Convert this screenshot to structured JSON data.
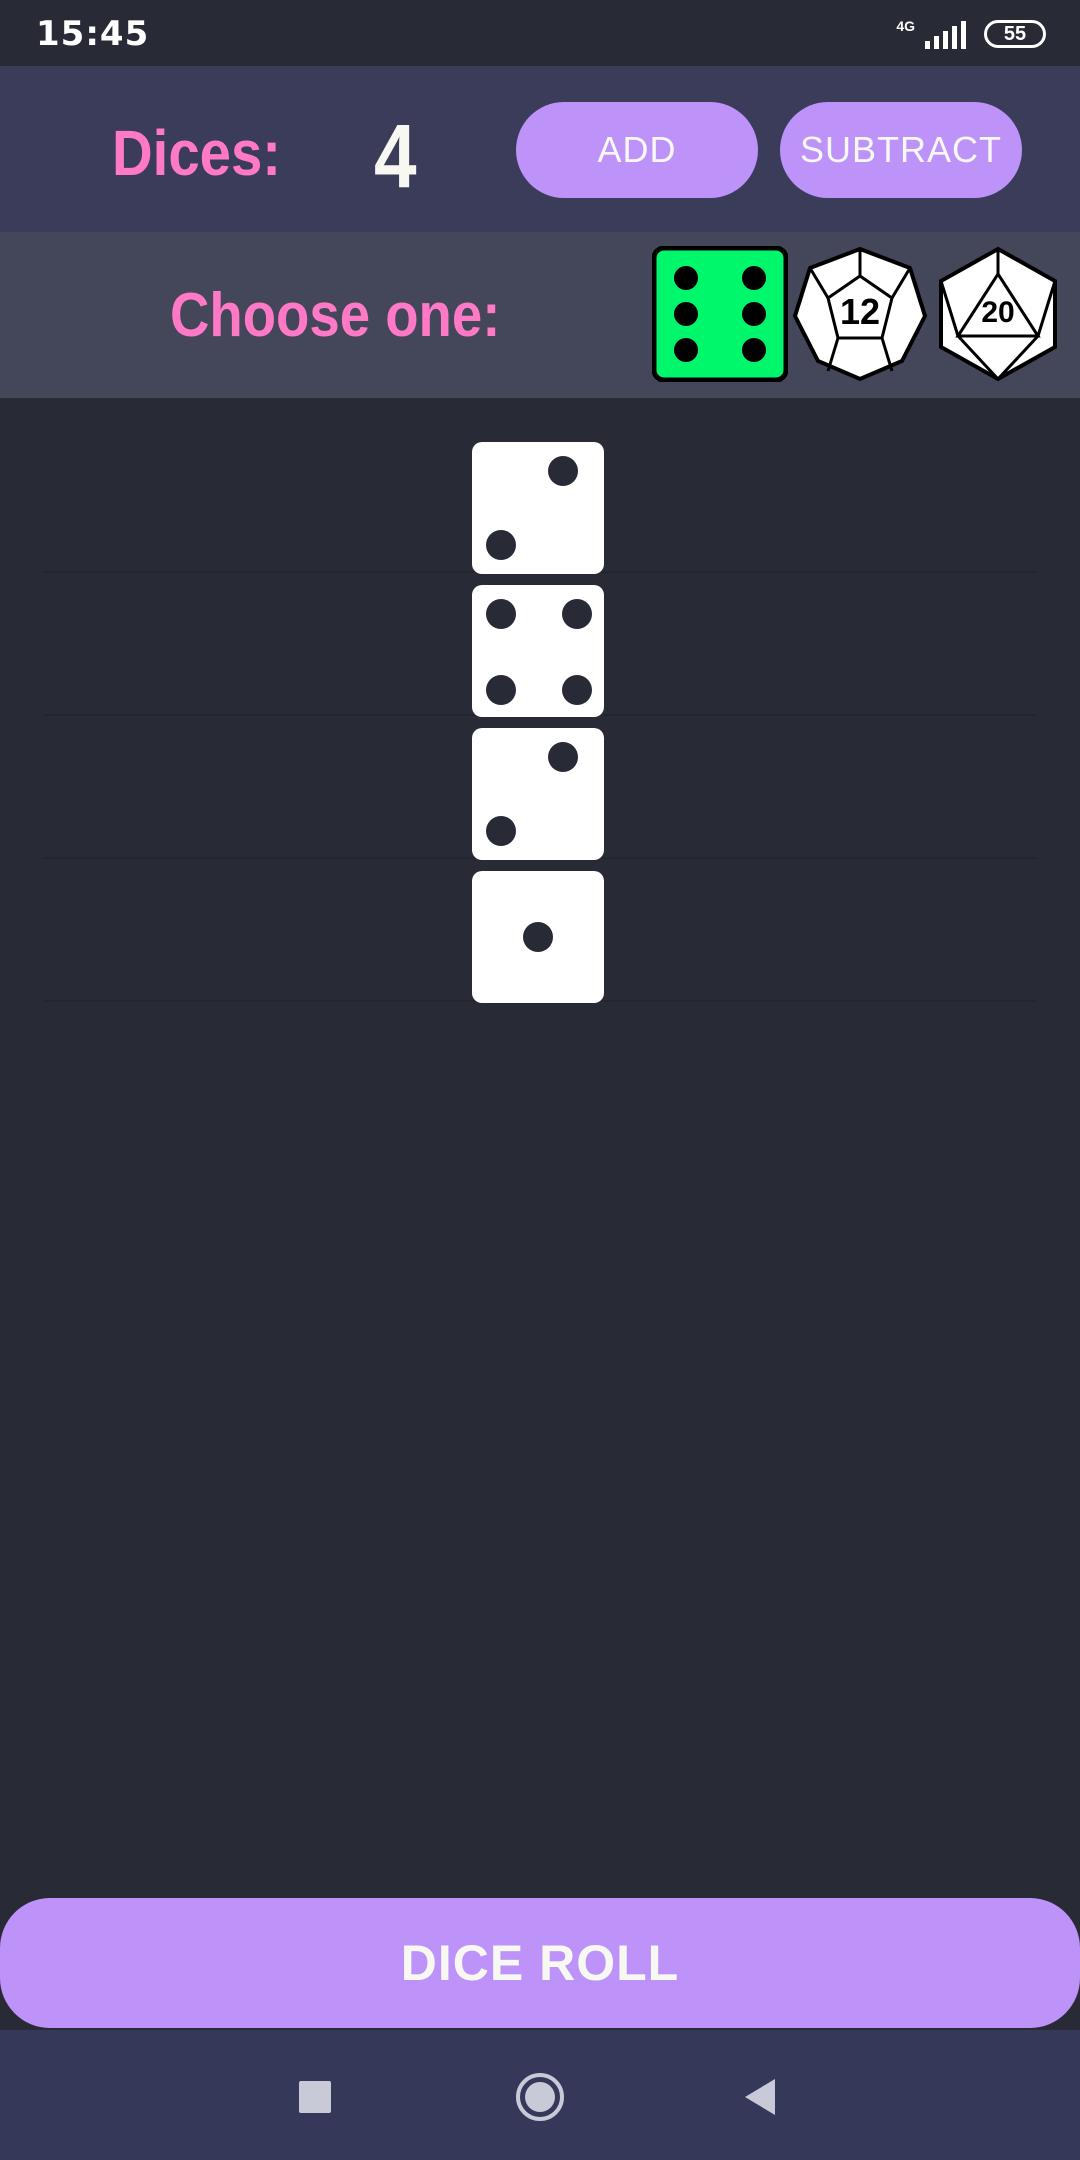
{
  "status_bar": {
    "time": "15:45",
    "network": "4G",
    "battery": "55"
  },
  "header": {
    "dices_label": "Dices:",
    "dice_count": "4",
    "add_label": "ADD",
    "subtract_label": "SUBTRACT"
  },
  "chooser": {
    "label": "Choose one:",
    "options": [
      {
        "name": "d6",
        "selected": true,
        "accent": "#00f76b"
      },
      {
        "name": "d12",
        "face_number": "12",
        "selected": false
      },
      {
        "name": "d20",
        "face_number": "20",
        "selected": false
      }
    ]
  },
  "dice_results": [
    2,
    4,
    2,
    1
  ],
  "roll_button": {
    "label": "DICE ROLL"
  },
  "colors": {
    "background": "#282a36",
    "header": "#3b3c5a",
    "chooser_bar": "#44475a",
    "accent_pink": "#ff79c6",
    "button_purple": "#bd93f9",
    "nav_bar": "#363859"
  },
  "nav_bar": {
    "icons": [
      "recent-apps-icon",
      "home-icon",
      "back-icon"
    ]
  }
}
